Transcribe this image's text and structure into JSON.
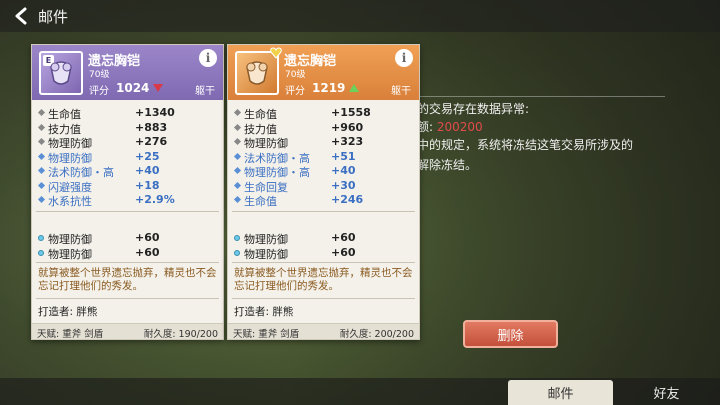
{
  "header": {
    "title": "邮件",
    "back_icon": "back-arrow-icon"
  },
  "mail": {
    "line1": "行的交易存在数据异常:",
    "line2_prefix": "金额: ",
    "line2_amount": "200200",
    "line3": "》中的规定，系统将冻结这笔交易所涉及的",
    "line4": "即解除冻结。",
    "delete_label": "删除",
    "amount_color": "#e04a4a"
  },
  "tabs": [
    {
      "label": "邮件",
      "active": true
    },
    {
      "label": "好友",
      "active": false
    }
  ],
  "cards": [
    {
      "grade": "E",
      "name": "遗忘胸铠",
      "level": "70级",
      "score_label": "评分",
      "score": "1024",
      "trend": "down",
      "slot": "躯干",
      "base_stats": [
        {
          "name": "生命值",
          "value": "+1340",
          "type": "base"
        },
        {
          "name": "技力值",
          "value": "+883",
          "type": "base"
        },
        {
          "name": "物理防御",
          "value": "+276",
          "type": "base"
        },
        {
          "name": "物理防御",
          "value": "+25",
          "type": "bonus"
        },
        {
          "name": "法术防御・高",
          "value": "+40",
          "type": "bonus"
        },
        {
          "name": "闪避强度",
          "value": "+18",
          "type": "bonus"
        },
        {
          "name": "水系抗性",
          "value": "+2.9%",
          "type": "bonus"
        }
      ],
      "gem_stats": [
        {
          "name": "物理防御",
          "value": "+60"
        },
        {
          "name": "物理防御",
          "value": "+60"
        }
      ],
      "description": "就算被整个世界遗忘抛弃，精灵也不会忘记打理他们的秀发。",
      "maker": "打造者: 胖熊",
      "talent": "天赋: 重斧 剑盾",
      "durability": "耐久度: 190/200"
    },
    {
      "grade": "",
      "name": "遗忘胸铠",
      "level": "70级",
      "score_label": "评分",
      "score": "1219",
      "trend": "up",
      "slot": "躯干",
      "base_stats": [
        {
          "name": "生命值",
          "value": "+1558",
          "type": "base"
        },
        {
          "name": "技力值",
          "value": "+960",
          "type": "base"
        },
        {
          "name": "物理防御",
          "value": "+323",
          "type": "base"
        },
        {
          "name": "法术防御・高",
          "value": "+51",
          "type": "bonus"
        },
        {
          "name": "物理防御・高",
          "value": "+40",
          "type": "bonus"
        },
        {
          "name": "生命回复",
          "value": "+30",
          "type": "bonus"
        },
        {
          "name": "生命值",
          "value": "+246",
          "type": "bonus"
        }
      ],
      "gem_stats": [
        {
          "name": "物理防御",
          "value": "+60"
        },
        {
          "name": "物理防御",
          "value": "+60"
        }
      ],
      "description": "就算被整个世界遗忘抛弃，精灵也不会忘记打理他们的秀发。",
      "maker": "打造者: 胖熊",
      "talent": "天赋: 重斧 剑盾",
      "durability": "耐久度: 200/200"
    }
  ]
}
